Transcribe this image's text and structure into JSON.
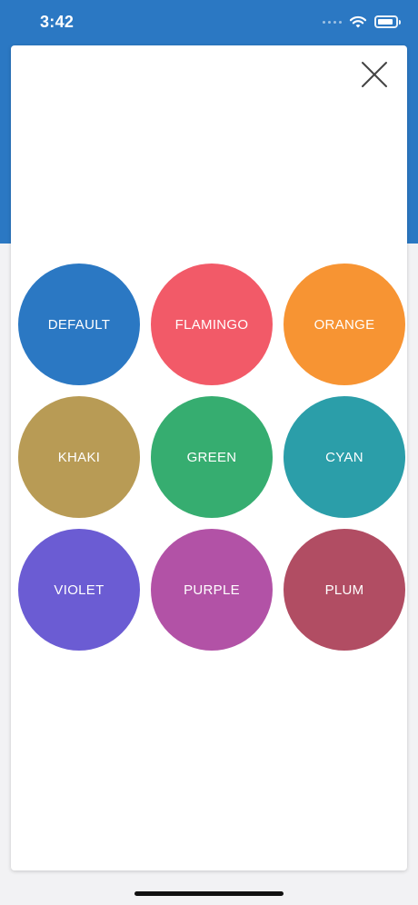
{
  "status_bar": {
    "time": "3:42",
    "background": "#2b78c3",
    "icons": [
      "signal-dots-icon",
      "wifi-icon",
      "battery-icon"
    ]
  },
  "sheet": {
    "close_icon": "close-icon"
  },
  "colors": [
    {
      "label": "DEFAULT",
      "hex": "#2b78c3"
    },
    {
      "label": "FLAMINGO",
      "hex": "#f25a68"
    },
    {
      "label": "ORANGE",
      "hex": "#f79433"
    },
    {
      "label": "KHAKI",
      "hex": "#b89b55"
    },
    {
      "label": "GREEN",
      "hex": "#36ad70"
    },
    {
      "label": "CYAN",
      "hex": "#2b9ea9"
    },
    {
      "label": "VIOLET",
      "hex": "#6b5cd3"
    },
    {
      "label": "PURPLE",
      "hex": "#b252a6"
    },
    {
      "label": "PLUM",
      "hex": "#b14d63"
    }
  ]
}
